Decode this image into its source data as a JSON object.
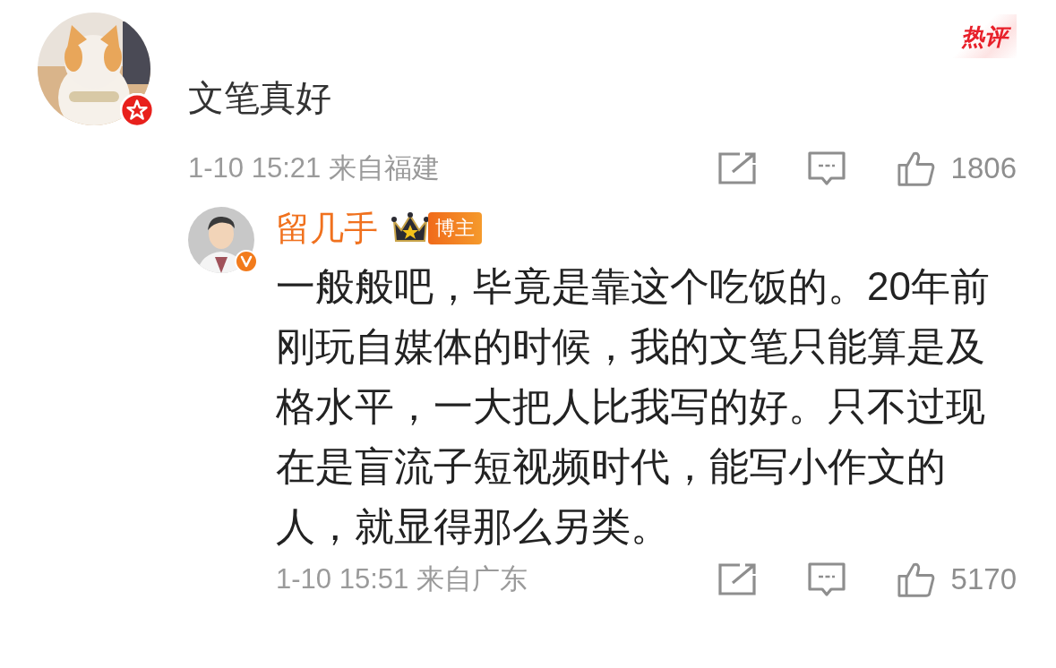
{
  "hot_label": "热评",
  "comment": {
    "text": "文笔真好",
    "meta": "1-10 15:21 来自福建",
    "likes": "1806"
  },
  "reply": {
    "author": "留几手",
    "author_badge": "博主",
    "text": "一般般吧，毕竟是靠这个吃饭的。20年前刚玩自媒体的时候，我的文笔只能算是及格水平，一大把人比我写的好。只不过现在是盲流子短视频时代，能写小作文的人，就显得那么另类。",
    "meta": "1-10 15:51 来自广东",
    "likes": "5170"
  }
}
